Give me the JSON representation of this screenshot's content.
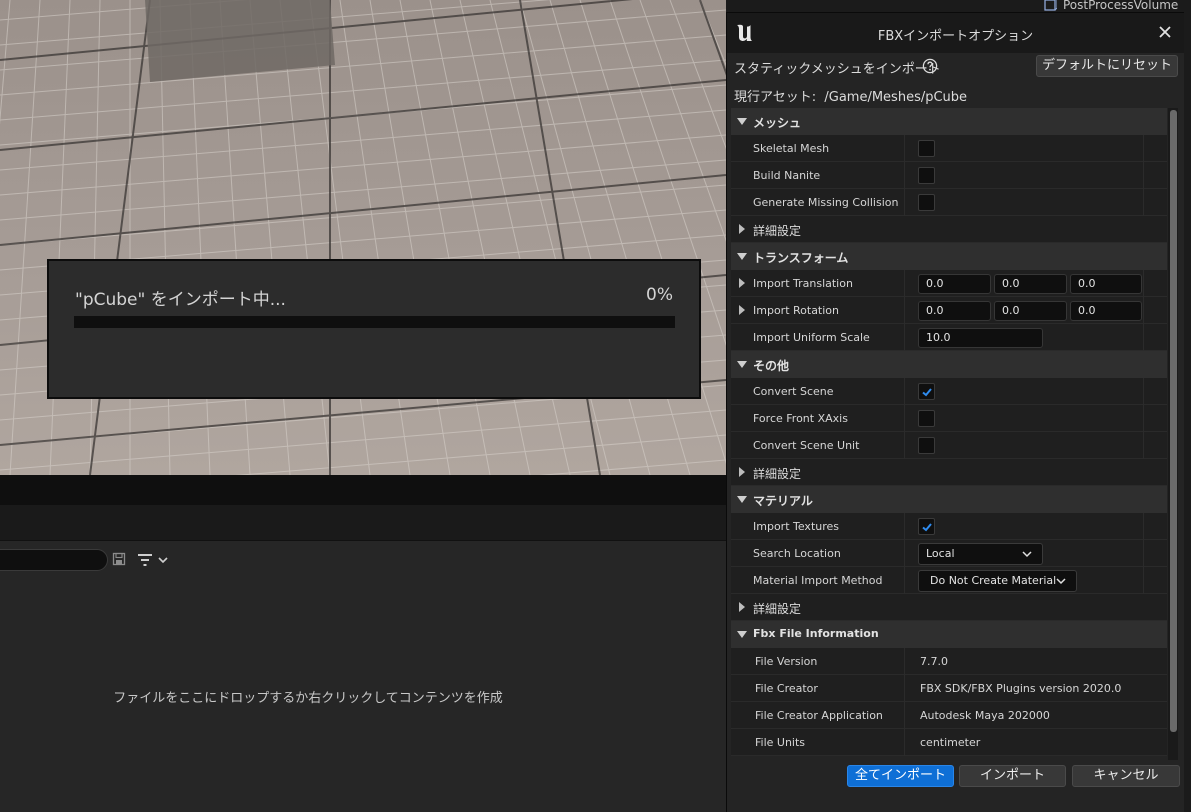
{
  "progress": {
    "text": "\"pCube\" をインポート中...",
    "percent_label": "0%",
    "fraction": 0
  },
  "content_browser": {
    "empty_text": "ファイルをここにドロップするか右クリックしてコンテンツを作成"
  },
  "outliner": {
    "item": "PostProcessVolume"
  },
  "dialog": {
    "title": "FBXインポートオプション",
    "import_type": "スタティックメッシュをインポート",
    "reset_label": "デフォルトにリセット",
    "current_asset": "現行アセット:  /Game/Meshes/pCube",
    "sections": {
      "mesh": "メッシュ",
      "transform": "トランスフォーム",
      "misc": "その他",
      "material": "マテリアル",
      "fbx_info": "Fbx File Information"
    },
    "advanced_label": "詳細設定",
    "mesh": {
      "skeletal_mesh": {
        "label": "Skeletal Mesh",
        "checked": false
      },
      "build_nanite": {
        "label": "Build Nanite",
        "checked": false
      },
      "generate_collision": {
        "label": "Generate Missing Collision",
        "checked": false
      }
    },
    "transform": {
      "translation": {
        "label": "Import Translation",
        "x": "0.0",
        "y": "0.0",
        "z": "0.0"
      },
      "rotation": {
        "label": "Import Rotation",
        "x": "0.0",
        "y": "0.0",
        "z": "0.0"
      },
      "scale": {
        "label": "Import Uniform Scale",
        "value": "10.0"
      }
    },
    "misc": {
      "convert_scene": {
        "label": "Convert Scene",
        "checked": true
      },
      "force_front_xaxis": {
        "label": "Force Front XAxis",
        "checked": false
      },
      "convert_scene_unit": {
        "label": "Convert Scene Unit",
        "checked": false
      }
    },
    "material": {
      "import_textures": {
        "label": "Import Textures",
        "checked": true
      },
      "search_location": {
        "label": "Search Location",
        "value": "Local"
      },
      "import_method": {
        "label": "Material Import Method",
        "value": "Do Not Create Material"
      }
    },
    "fbx_info": {
      "version": {
        "label": "File Version",
        "value": "7.7.0"
      },
      "creator": {
        "label": "File Creator",
        "value": "FBX SDK/FBX Plugins version 2020.0"
      },
      "creator_app": {
        "label": "File Creator Application",
        "value": "Autodesk Maya 202000"
      },
      "units": {
        "label": "File Units",
        "value": "centimeter"
      }
    },
    "buttons": {
      "import_all": "全てインポート",
      "import": "インポート",
      "cancel": "キャンセル"
    },
    "colors": {
      "accent": "#0e6fd6",
      "checkmark": "#2f8cf0"
    }
  }
}
